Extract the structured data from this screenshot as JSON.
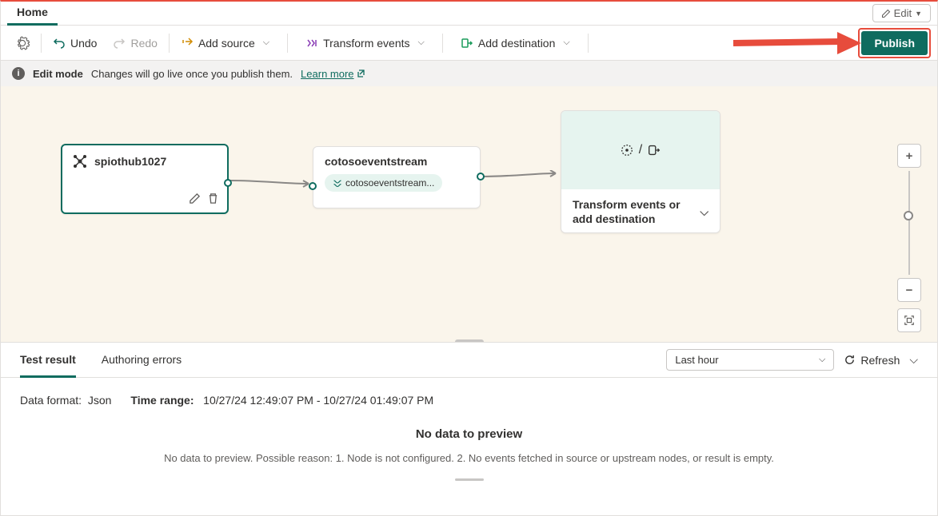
{
  "topTabs": {
    "home": "Home"
  },
  "editDropdown": "Edit",
  "toolbar": {
    "undo": "Undo",
    "redo": "Redo",
    "addSource": "Add source",
    "transformEvents": "Transform events",
    "addDestination": "Add destination",
    "publish": "Publish"
  },
  "infoBar": {
    "mode": "Edit mode",
    "msg": "Changes will go live once you publish them.",
    "learn": "Learn more"
  },
  "canvas": {
    "node1": {
      "title": "spiothub1027"
    },
    "node2": {
      "title": "cotosoeventstream",
      "pill": "cotosoeventstream..."
    },
    "node3": {
      "label": "Transform events or add destination"
    }
  },
  "bottom": {
    "tabs": {
      "testResult": "Test result",
      "authErrors": "Authoring errors"
    },
    "range": "Last hour",
    "refresh": "Refresh",
    "dataFormatLbl": "Data format:",
    "dataFormatVal": "Json",
    "timeRangeLbl": "Time range:",
    "timeRangeVal": "10/27/24 12:49:07 PM - 10/27/24 01:49:07 PM",
    "noDataTitle": "No data to preview",
    "noDataSub": "No data to preview. Possible reason: 1. Node is not configured. 2. No events fetched in source or upstream nodes, or result is empty."
  }
}
